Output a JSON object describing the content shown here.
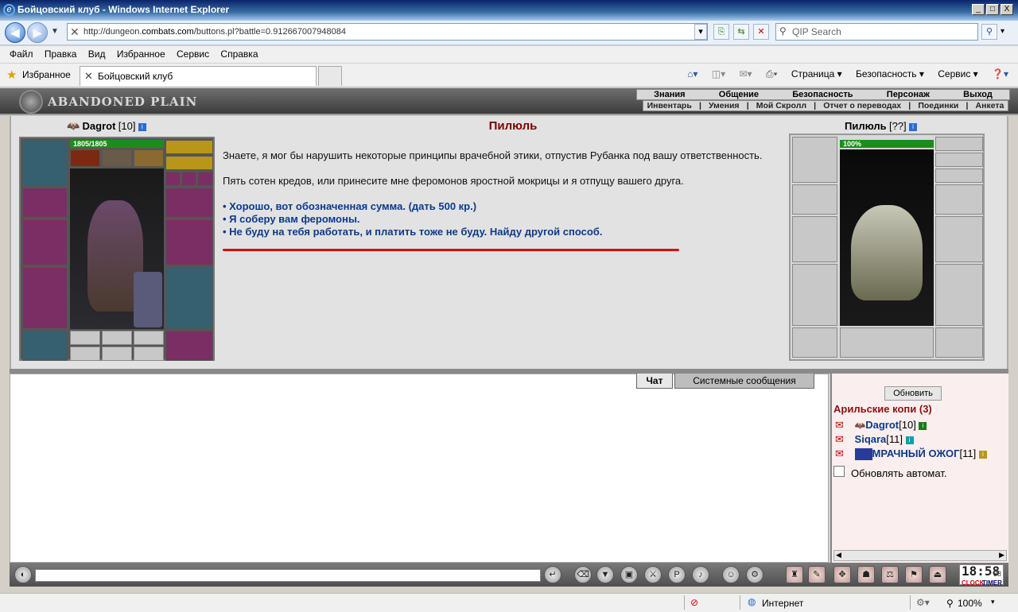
{
  "window": {
    "title": "Бойцовский клуб - Windows Internet Explorer",
    "min": "_",
    "max": "□",
    "close": "X"
  },
  "address": {
    "url_prefix": "http://dungeon.",
    "url_domain": "combats.com",
    "url_suffix": "/buttons.pl?battle=0.912667007948084",
    "search_placeholder": "QIP Search"
  },
  "menu": [
    "Файл",
    "Правка",
    "Вид",
    "Избранное",
    "Сервис",
    "Справка"
  ],
  "favorites": {
    "label": "Избранное",
    "tab_title": "Бойцовский клуб"
  },
  "commandbar": [
    "Страница ▾",
    "Безопасность ▾",
    "Сервис ▾"
  ],
  "game": {
    "logo": "ABANDONED PLAIN",
    "nav": [
      "Знания",
      "Общение",
      "Безопасность",
      "Персонаж",
      "Выход"
    ],
    "subnav": [
      "Инвентарь",
      "Умения",
      "Мой Скролл",
      "Отчет о переводах",
      "Поединки",
      "Анкета"
    ],
    "player": {
      "name": "Dagrot",
      "level": "[10]",
      "hp": "1805/1805"
    },
    "npc": {
      "name": "Пилюль",
      "level": "[??]",
      "hp": "100%"
    },
    "dialog_title": "Пилюль",
    "dialog": [
      "Знаете, я мог бы нарушить некоторые принципы врачебной этики, отпустив Рубанка под вашу ответственность.",
      "Пять сотен кредов, или принесите мне феромонов яростной мокрицы и я отпущу вашего друга."
    ],
    "options": [
      "• Хорошо, вот обозначенная сумма. (дать 500 кр.)",
      "• Я соберу вам феромоны.",
      "• Не буду на тебя работать, и платить тоже не буду. Найду другой способ."
    ]
  },
  "chat": {
    "tabs": [
      "Чат",
      "Системные сообщения"
    ],
    "refresh": "Обновить",
    "location": "Арильские копи (3)",
    "players": [
      {
        "name": "Dagrot",
        "level": "[10]"
      },
      {
        "name": "Siqara",
        "level": "[11]"
      },
      {
        "name": "МРАЧНЫЙ ОЖОГ",
        "level": "[11]"
      }
    ],
    "auto_refresh": "Обновлять автомат."
  },
  "clock": {
    "time": "18:58",
    "seconds": "38",
    "clock_label": "CLOCK",
    "timer_label": "TIMER"
  },
  "status": {
    "zone": "Интернет",
    "zoom": "100%"
  }
}
